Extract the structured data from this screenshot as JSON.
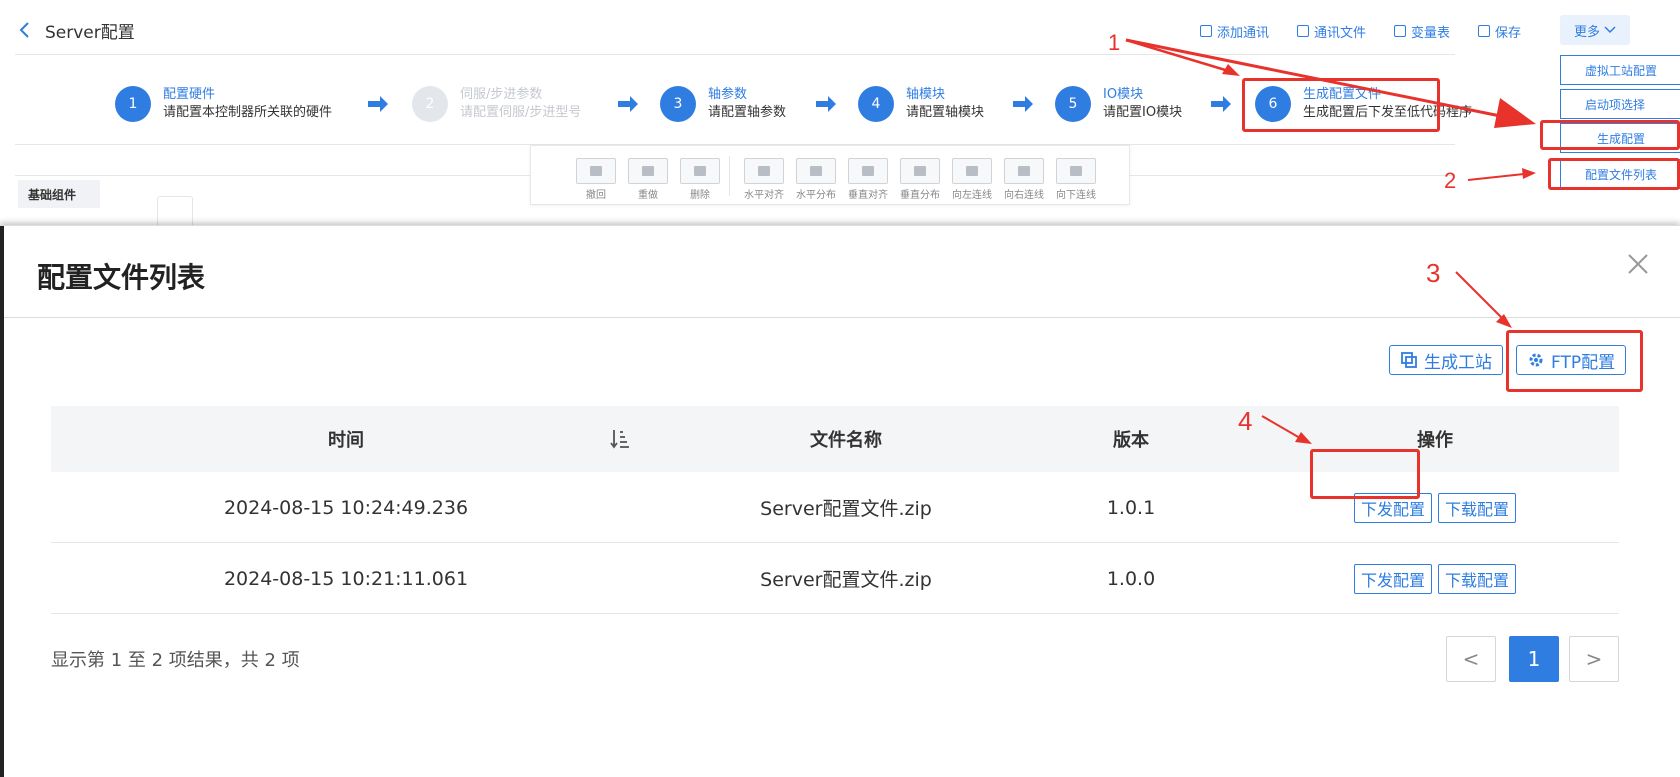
{
  "header": {
    "title": "Server配置",
    "toolbar": [
      "添加通讯",
      "通讯文件",
      "变量表",
      "保存"
    ],
    "more_label": "更多"
  },
  "steps": [
    {
      "num": "1",
      "title": "配置硬件",
      "sub": "请配置本控制器所关联的硬件",
      "state": "active"
    },
    {
      "num": "2",
      "title": "伺服/步进参数",
      "sub": "请配置伺服/步进型号",
      "state": "disabled"
    },
    {
      "num": "3",
      "title": "轴参数",
      "sub": "请配置轴参数",
      "state": "active"
    },
    {
      "num": "4",
      "title": "轴模块",
      "sub": "请配置轴模块",
      "state": "active"
    },
    {
      "num": "5",
      "title": "IO模块",
      "sub": "请配置IO模块",
      "state": "active"
    },
    {
      "num": "6",
      "title": "生成配置文件",
      "sub": "生成配置后下发至低代码程序",
      "state": "active"
    }
  ],
  "more_menu": [
    "虚拟工站配置",
    "启动项选择",
    "生成配置",
    "配置文件列表"
  ],
  "edit_toolbar": [
    "撤回",
    "重做",
    "删除",
    "水平对齐",
    "水平分布",
    "垂直对齐",
    "垂直分布",
    "向左连线",
    "向右连线",
    "向下连线"
  ],
  "left_panel": {
    "tab": "基础组件"
  },
  "annotations": [
    "1",
    "2",
    "3",
    "4"
  ],
  "colors": {
    "accent": "#2f7de1",
    "annotation": "#e8322c"
  },
  "dialog": {
    "title": "配置文件列表",
    "actions": {
      "generate_station": "生成工站",
      "ftp_config": "FTP配置"
    },
    "columns": [
      "时间",
      "文件名称",
      "版本",
      "操作"
    ],
    "rows": [
      {
        "time": "2024-08-15 10:24:49.236",
        "file": "Server配置文件.zip",
        "version": "1.0.1",
        "ops": [
          "下发配置",
          "下载配置"
        ]
      },
      {
        "time": "2024-08-15 10:21:11.061",
        "file": "Server配置文件.zip",
        "version": "1.0.0",
        "ops": [
          "下发配置",
          "下载配置"
        ]
      }
    ],
    "summary": "显示第 1 至 2 项结果，共 2 项",
    "pagination": {
      "prev": "<",
      "current": "1",
      "next": ">"
    }
  }
}
